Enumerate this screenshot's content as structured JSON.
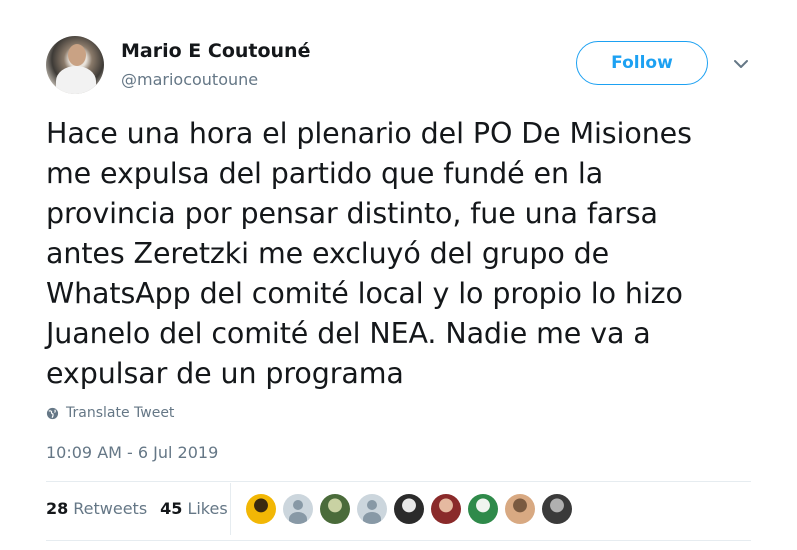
{
  "author": {
    "display_name": "Mario E Coutouné",
    "handle": "@mariocoutoune",
    "avatar_icon": "profile-photo"
  },
  "header": {
    "follow_label": "Follow",
    "menu_icon": "chevron-down-icon"
  },
  "tweet": {
    "text": "Hace una hora el plenario del PO De Misiones\nme expulsa del partido que fundé en la\nprovincia por pensar distinto, fue una farsa\nantes Zeretzki me excluyó del grupo de\nWhatsApp del comité local y lo propio lo hizo\nJuanelo del comité del NEA. Nadie me va a\nexpulsar de un programa",
    "translate_label": "Translate Tweet",
    "timestamp": "10:09 AM - 6 Jul 2019"
  },
  "stats": {
    "retweets_count": "28",
    "retweets_label": "Retweets",
    "likes_count": "45",
    "likes_label": "Likes"
  },
  "likers": [
    {
      "type": "photo",
      "color": "#f2b705",
      "accent": "#3a2a10"
    },
    {
      "type": "default"
    },
    {
      "type": "photo",
      "color": "#4a6b3a",
      "accent": "#c9d2a3"
    },
    {
      "type": "default"
    },
    {
      "type": "photo",
      "color": "#2b2b2b",
      "accent": "#e9e9e9"
    },
    {
      "type": "photo",
      "color": "#8a2a2a",
      "accent": "#e5b9a0"
    },
    {
      "type": "photo",
      "color": "#2f8a4a",
      "accent": "#f0f4ef"
    },
    {
      "type": "photo",
      "color": "#d8a982",
      "accent": "#7a5a40"
    },
    {
      "type": "photo",
      "color": "#3a3a3a",
      "accent": "#b0b0b0"
    }
  ],
  "colors": {
    "accent": "#1da1f2",
    "text": "#14171a",
    "muted": "#657786",
    "divider": "#e6ecf0"
  }
}
